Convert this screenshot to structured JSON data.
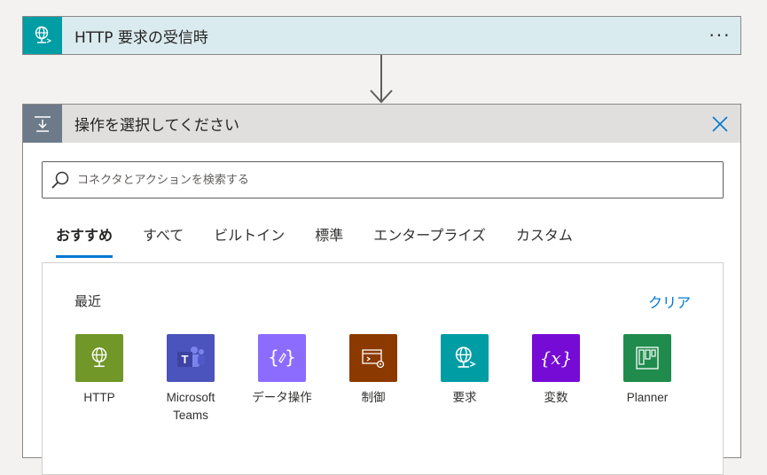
{
  "trigger": {
    "title": "HTTP 要求の受信時",
    "more_label": "···",
    "icon_color": "#009da5",
    "background": "#daebef"
  },
  "action": {
    "title": "操作を選択してください",
    "icon_color": "#6c7a89",
    "close_icon": "close-icon"
  },
  "search": {
    "placeholder": "コネクタとアクションを検索する"
  },
  "tabs": [
    {
      "label": "おすすめ",
      "active": true
    },
    {
      "label": "すべて",
      "active": false
    },
    {
      "label": "ビルトイン",
      "active": false
    },
    {
      "label": "標準",
      "active": false
    },
    {
      "label": "エンタープライズ",
      "active": false
    },
    {
      "label": "カスタム",
      "active": false
    }
  ],
  "recent": {
    "label": "最近",
    "clear_label": "クリア",
    "connectors": [
      {
        "name": "HTTP",
        "icon": "globe-icon",
        "color": "#709727"
      },
      {
        "name": "Microsoft Teams",
        "icon": "teams-icon",
        "color": "#4b53bc"
      },
      {
        "name": "データ操作",
        "icon": "data-operations-icon",
        "color": "#8c6cff"
      },
      {
        "name": "制御",
        "icon": "control-icon",
        "color": "#8c3900"
      },
      {
        "name": "要求",
        "icon": "request-icon",
        "color": "#009da5"
      },
      {
        "name": "変数",
        "icon": "variable-icon",
        "color": "#770bd6"
      },
      {
        "name": "Planner",
        "icon": "planner-icon",
        "color": "#1f8b4c"
      }
    ]
  },
  "accent_color": "#0078d4"
}
